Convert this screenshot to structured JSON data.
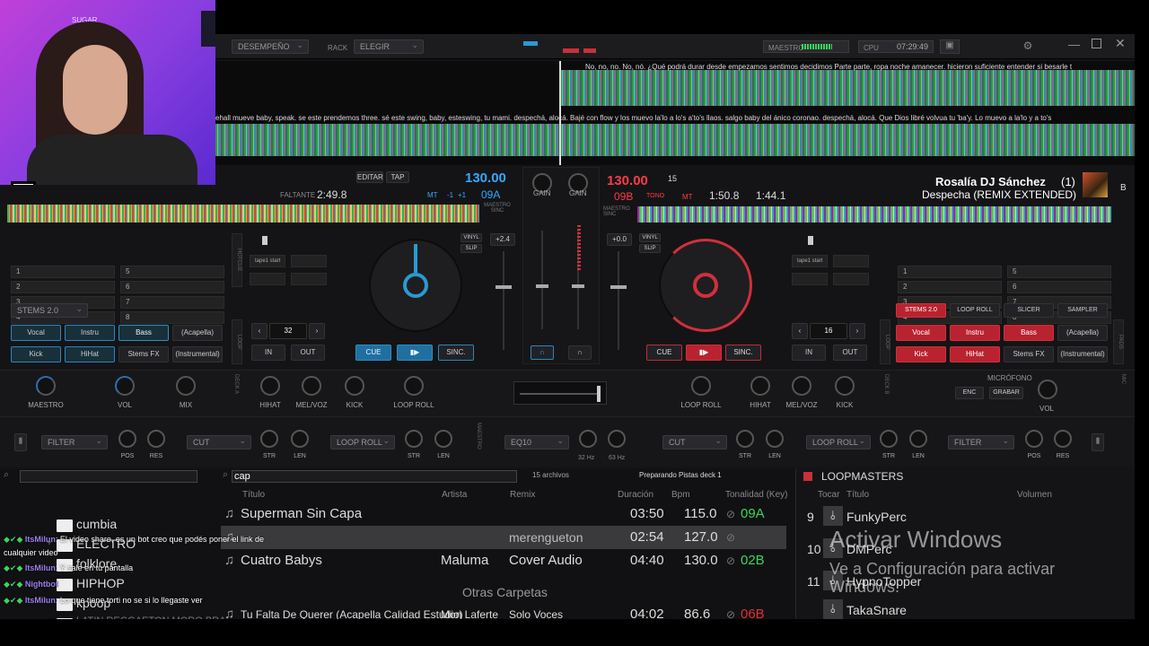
{
  "topbar": {
    "mode": "DESEMPEÑO",
    "rack_label": "RACK",
    "rack_value": "ELEGIR",
    "master_label": "MAESTRO",
    "cpu_label": "CPU",
    "clock": "07:29:49"
  },
  "lyrics": {
    "top": "No, no, no.   No, nó. ¿Qué podrá durar desde empezamos sentimos decidimos   Parte parte, ropa noche amanecer. hicieron suficiente entender si besarle t",
    "bottom": "ehall mueve     baby, speak. se este prendemos three. sé este swing,    baby, esteswing, tu mami. despechá, alocá.   Bajé con flow      y   los muevo la'lo a lo's a'to's llaos. salgo baby del ánico coronao. despechá, alocá. Que Dios libré volvua tu 'ba'y.   Lo muevo a la'lo y a to's"
  },
  "deck_left": {
    "faltante_label": "FALTANTE",
    "remaining": "2:49.8",
    "edit": "EDITAR",
    "tap": "TAP",
    "bpm": "130.00",
    "key": "09A",
    "mt": "MT",
    "pitch_offset": "-1",
    "pitch_up": "+1",
    "maestro_sinc": "MAESTRO SINC",
    "cue_slots": [
      "1",
      "2",
      "3",
      "4",
      "5",
      "6",
      "7",
      "8"
    ],
    "pitch_range": "+2.4",
    "stems_preset": "STEMS 2.0",
    "stems": [
      "Vocal",
      "Instru",
      "Bass",
      "(Acapella)",
      "Kick",
      "HiHat",
      "Stems FX",
      "(Instrumental)"
    ],
    "loop_size": "32",
    "in": "IN",
    "out": "OUT",
    "cue": "CUE",
    "sync": "SINC.",
    "vinyl": "VINYL",
    "slip": "SLIP",
    "pad_label": "tape1 start",
    "loop_side": "LOOP",
    "hotcue_side": "HOTCUE"
  },
  "deck_right": {
    "artist": "Rosalía  DJ Sánchez",
    "deck_index": "(1)",
    "title": "Despecha (REMIX EXTENDED)",
    "deck_letter": "B",
    "bpm": "130.00",
    "key": "09B",
    "tono": "TONO",
    "mt": "MT",
    "pitch_number": "15",
    "elapsed": "1:50.8",
    "remaining": "1:44.1",
    "maestro_sinc": "MAESTRO SINC",
    "cue_slots": [
      "1",
      "2",
      "3",
      "4",
      "5",
      "6",
      "7",
      "8"
    ],
    "pitch_range": "+0.0",
    "pad_tabs": [
      "STEMS 2.0",
      "LOOP ROLL",
      "SLICER",
      "SAMPLER"
    ],
    "stems": [
      "Vocal",
      "Instru",
      "Bass",
      "(Acapella)",
      "Kick",
      "HiHat",
      "Stems FX",
      "(Instrumental)"
    ],
    "loop_size": "16",
    "in": "IN",
    "out": "OUT",
    "cue": "CUE",
    "sync": "SINC.",
    "vinyl": "VINYL",
    "slip": "SLIP",
    "pad_label": "tape1 start",
    "loop_side": "LOOP",
    "pads_side": "PADS"
  },
  "mixer": {
    "gain_left": "GAIN",
    "gain_right": "GAIN"
  },
  "fx_row": {
    "left_knobs": [
      "MAESTRO",
      "VOL",
      "MIX"
    ],
    "left_fx": [
      "HIHAT",
      "MEL/VOZ",
      "KICK",
      "LOOP ROLL"
    ],
    "right_fx": [
      "LOOP ROLL",
      "HIHAT",
      "MEL/VOZ",
      "KICK"
    ],
    "mic_label": "MICRÓFONO",
    "mic_enc": "ENC",
    "mic_grabar": "GRABAR",
    "mic_vol": "VOL",
    "side_left": "DECK A",
    "side_right": "DECK B",
    "side_mic": "MIC"
  },
  "filter_row": {
    "left": {
      "filter": "FILTER",
      "pos": "POS",
      "res": "RES",
      "cut": "CUT",
      "str": "STR",
      "len": "LEN",
      "loop_roll": "LOOP ROLL",
      "str2": "STR",
      "len2": "LEN"
    },
    "center": {
      "label": "MAESTRO",
      "eq": "EQ10",
      "hz1": "32 Hz",
      "hz2": "63 Hz"
    },
    "right": {
      "cut": "CUT",
      "str": "STR",
      "len": "LEN",
      "loop_roll": "LOOP ROLL",
      "str2": "STR",
      "len2": "LEN",
      "filter": "FILTER",
      "pos": "POS",
      "res": "RES"
    }
  },
  "browser": {
    "search_value": "cap",
    "file_count": "15 archivos",
    "status": "Preparando Pistas deck 1",
    "columns": {
      "title": "Título",
      "artist": "Artista",
      "remix": "Remix",
      "duration": "Duración",
      "bpm": "Bpm",
      "key": "Tonalidad (Key)"
    },
    "tracks": [
      {
        "title": "Superman Sin Capa",
        "artist": "",
        "remix": "",
        "duration": "03:50",
        "bpm": "115.0",
        "key": "09A"
      },
      {
        "title": "",
        "artist": "",
        "remix": "merengueton",
        "duration": "02:54",
        "bpm": "127.0",
        "key": ""
      },
      {
        "title": "Cuatro Babys",
        "artist": "Maluma",
        "remix": "Cover Audio",
        "duration": "04:40",
        "bpm": "130.0",
        "key": "02B"
      },
      {
        "title": "Tu Falta De Querer (Acapella Calidad Estudio)",
        "artist": "Mon Laferte",
        "remix": "Solo Voces",
        "duration": "04:02",
        "bpm": "86.6",
        "key": "06B"
      }
    ],
    "other_folders": "Otras Carpetas",
    "folders": [
      "cumbia",
      "ELECTRO",
      "folklore",
      "HIPHOP",
      "kpoop",
      "LATIN REGGAETON MORO BRA"
    ]
  },
  "sampler": {
    "name": "LOOPMASTERS",
    "col_play": "Tocar",
    "col_title": "Título",
    "col_volume": "Volumen",
    "items": [
      {
        "n": "9",
        "name": "FunkyPerc"
      },
      {
        "n": "10",
        "name": "DMPerc"
      },
      {
        "n": "11",
        "name": "HypnoTopper"
      },
      {
        "n": "",
        "name": "TakaSnare"
      }
    ]
  },
  "chat": [
    {
      "user": "ItsMilun",
      "msg": ": El video share, es un bot creo que podés poner el link de"
    },
    {
      "user": "",
      "msg": "cualquier video"
    },
    {
      "user": "ItsMilun",
      "msg": ": Y sale en tu pantalla"
    },
    {
      "user": "Nightbot",
      "msg": ""
    },
    {
      "user": "ItsMilun",
      "msg": ": Lo que tiene torti no se si lo llegaste ver"
    }
  ],
  "watermark": {
    "line1": "Activar Windows",
    "line2": "Ve a Configuración para activar",
    "line3": "Windows."
  },
  "webcam": {
    "overlay_text": "SUGAR"
  },
  "colors": {
    "accent_blue": "#1f8fd0",
    "accent_red": "#d0303c",
    "key_green": "#3dd45a",
    "key_red": "#e03030",
    "chat_name": "#9b7ef0"
  }
}
